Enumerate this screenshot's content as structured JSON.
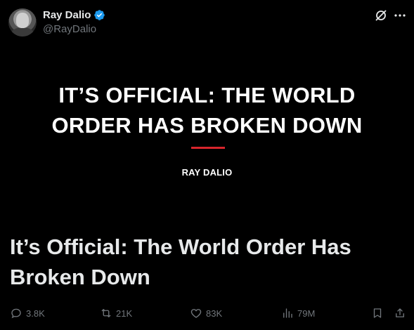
{
  "author": {
    "name": "Ray Dalio",
    "handle": "@RayDalio",
    "verified": true
  },
  "header_icons": [
    "grok-icon",
    "more-icon"
  ],
  "card": {
    "title_line1": "IT’S OFFICIAL: THE WORLD",
    "title_line2": "ORDER HAS BROKEN DOWN",
    "author_label": "RAY DALIO",
    "accent_color": "#d8262c"
  },
  "headline": {
    "line1": "It’s Official: The World Order Has",
    "line2": "Broken Down"
  },
  "actions": {
    "replies": "3.8K",
    "reposts": "21K",
    "likes": "83K",
    "views": "79M"
  },
  "colors": {
    "background": "#000000",
    "text": "#e7e9ea",
    "muted": "#71767b",
    "verified": "#1d9bf0"
  }
}
